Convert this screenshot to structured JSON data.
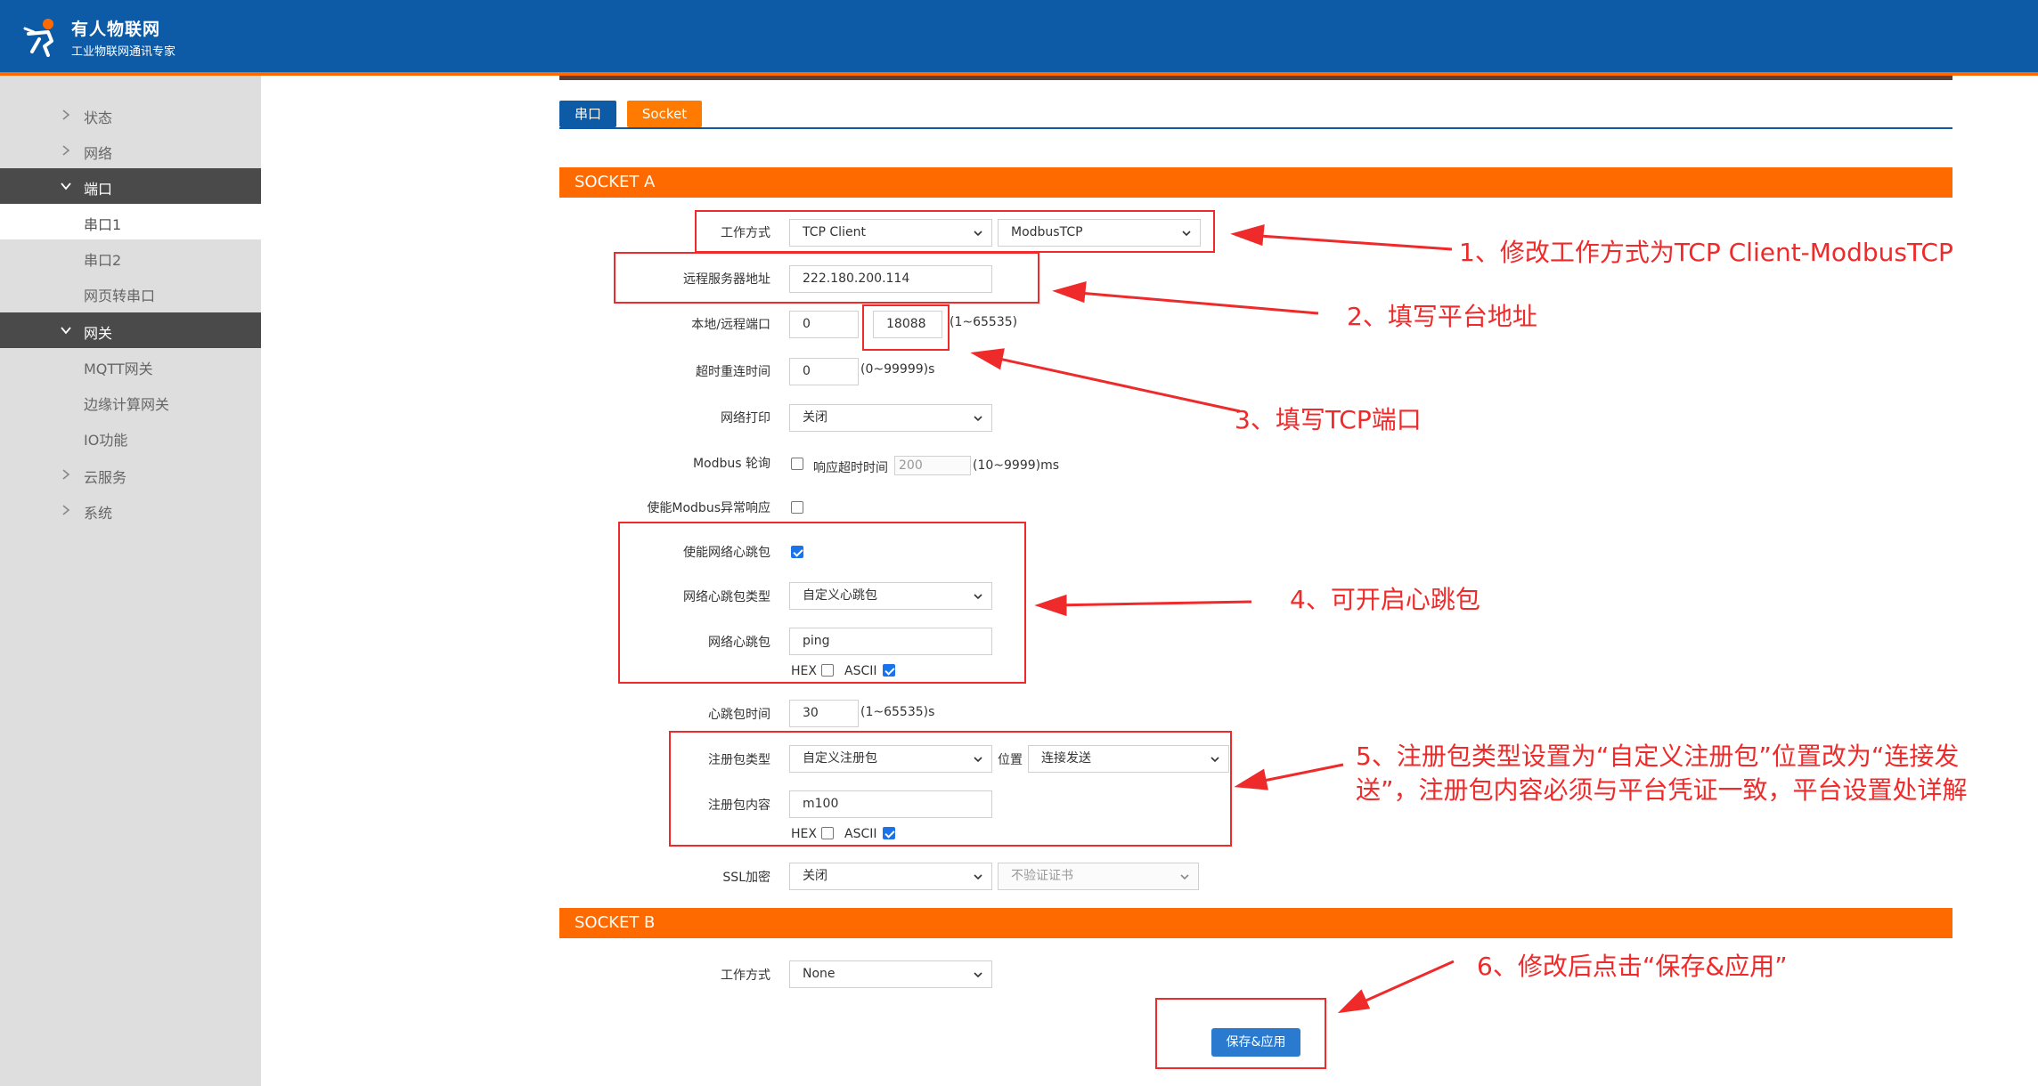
{
  "brand": {
    "title": "有人物联网",
    "subtitle": "工业物联网通讯专家"
  },
  "sidebar": {
    "items": [
      {
        "label": "状态"
      },
      {
        "label": "网络"
      },
      {
        "label": "端口"
      },
      {
        "label": "串口1"
      },
      {
        "label": "串口2"
      },
      {
        "label": "网页转串口"
      },
      {
        "label": "网关"
      },
      {
        "label": "MQTT网关"
      },
      {
        "label": "边缘计算网关"
      },
      {
        "label": "IO功能"
      },
      {
        "label": "云服务"
      },
      {
        "label": "系统"
      }
    ]
  },
  "tabs": {
    "serial": "串口",
    "socket": "Socket"
  },
  "socket_a": {
    "title": "SOCKET A",
    "work_mode": {
      "label": "工作方式",
      "value": "TCP Client",
      "protocol": "ModbusTCP"
    },
    "server_addr": {
      "label": "远程服务器地址",
      "value": "222.180.200.114"
    },
    "ports": {
      "label": "本地/远程端口",
      "local": "0",
      "remote": "18088",
      "hint": "(1~65535)"
    },
    "reconnect": {
      "label": "超时重连时间",
      "value": "0",
      "hint": "(0~99999)s"
    },
    "net_print": {
      "label": "网络打印",
      "value": "关闭"
    },
    "modbus_poll": {
      "label": "Modbus 轮询",
      "timeout_label": "响应超时时间",
      "timeout_value": "200",
      "hint": "(10~9999)ms"
    },
    "modbus_exception": {
      "label": "使能Modbus异常响应"
    },
    "heartbeat_enable": {
      "label": "使能网络心跳包"
    },
    "heartbeat_type": {
      "label": "网络心跳包类型",
      "value": "自定义心跳包"
    },
    "heartbeat_data": {
      "label": "网络心跳包",
      "value": "ping",
      "hex": "HEX",
      "ascii": "ASCII"
    },
    "heartbeat_time": {
      "label": "心跳包时间",
      "value": "30",
      "hint": "(1~65535)s"
    },
    "register_type": {
      "label": "注册包类型",
      "value": "自定义注册包",
      "position_label": "位置",
      "position_value": "连接发送"
    },
    "register_data": {
      "label": "注册包内容",
      "value": "m100",
      "hex": "HEX",
      "ascii": "ASCII"
    },
    "ssl": {
      "label": "SSL加密",
      "value": "关闭",
      "cert": "不验证证书"
    }
  },
  "socket_b": {
    "title": "SOCKET B",
    "work_mode": {
      "label": "工作方式",
      "value": "None"
    }
  },
  "save_button": "保存&应用",
  "annotations": {
    "note1": "1、修改工作方式为TCP Client-ModbusTCP",
    "note2": "2、填写平台地址",
    "note3": "3、填写TCP端口",
    "note4": "4、可开启心跳包",
    "note5_line1": "5、注册包类型设置为“自定义注册包”位置改为“连接发",
    "note5_line2": "送”，注册包内容必须与平台凭证一致，平台设置处详解",
    "note6": "6、修改后点击“保存&应用”"
  },
  "colors": {
    "header": "#0d5aa7",
    "accent": "#ff6a00",
    "annotation": "#ee2a2a",
    "sidebar": "#dedede"
  }
}
